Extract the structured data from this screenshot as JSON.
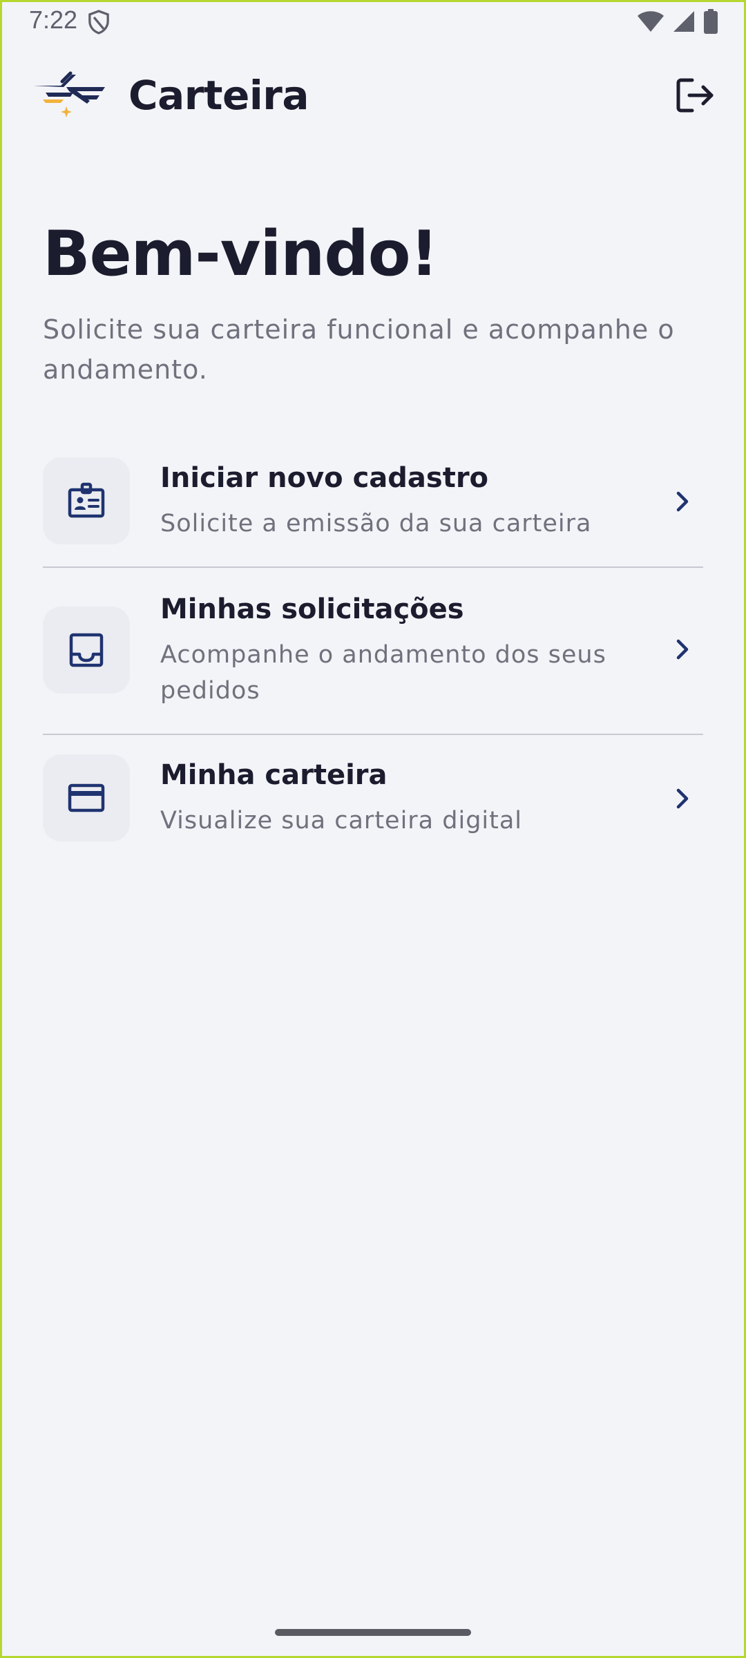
{
  "status_bar": {
    "time": "7:22",
    "icons": [
      "shield-icon",
      "wifi-icon",
      "signal-icon",
      "battery-icon"
    ]
  },
  "app_bar": {
    "title": "Carteira",
    "logo_icon": "wings-logo-icon",
    "logout_icon": "logout-icon"
  },
  "welcome": {
    "title": "Bem-vindo!",
    "subtitle": "Solicite sua carteira funcional e acompanhe o andamento."
  },
  "menu": {
    "items": [
      {
        "title": "Iniciar novo cadastro",
        "description": "Solicite a emissão da sua carteira",
        "icon": "id-badge-icon"
      },
      {
        "title": "Minhas solicitações",
        "description": "Acompanhe o andamento dos seus pedidos",
        "icon": "inbox-icon"
      },
      {
        "title": "Minha carteira",
        "description": "Visualize sua carteira digital",
        "icon": "credit-card-icon"
      }
    ]
  },
  "colors": {
    "background": "#f3f4f8",
    "primary_text": "#1b1d2e",
    "secondary_text": "#6f717c",
    "icon_navy": "#1f3370",
    "accent_gold": "#f2b23a",
    "divider": "#c8c9d1",
    "icon_box_bg": "#ebecf1"
  }
}
